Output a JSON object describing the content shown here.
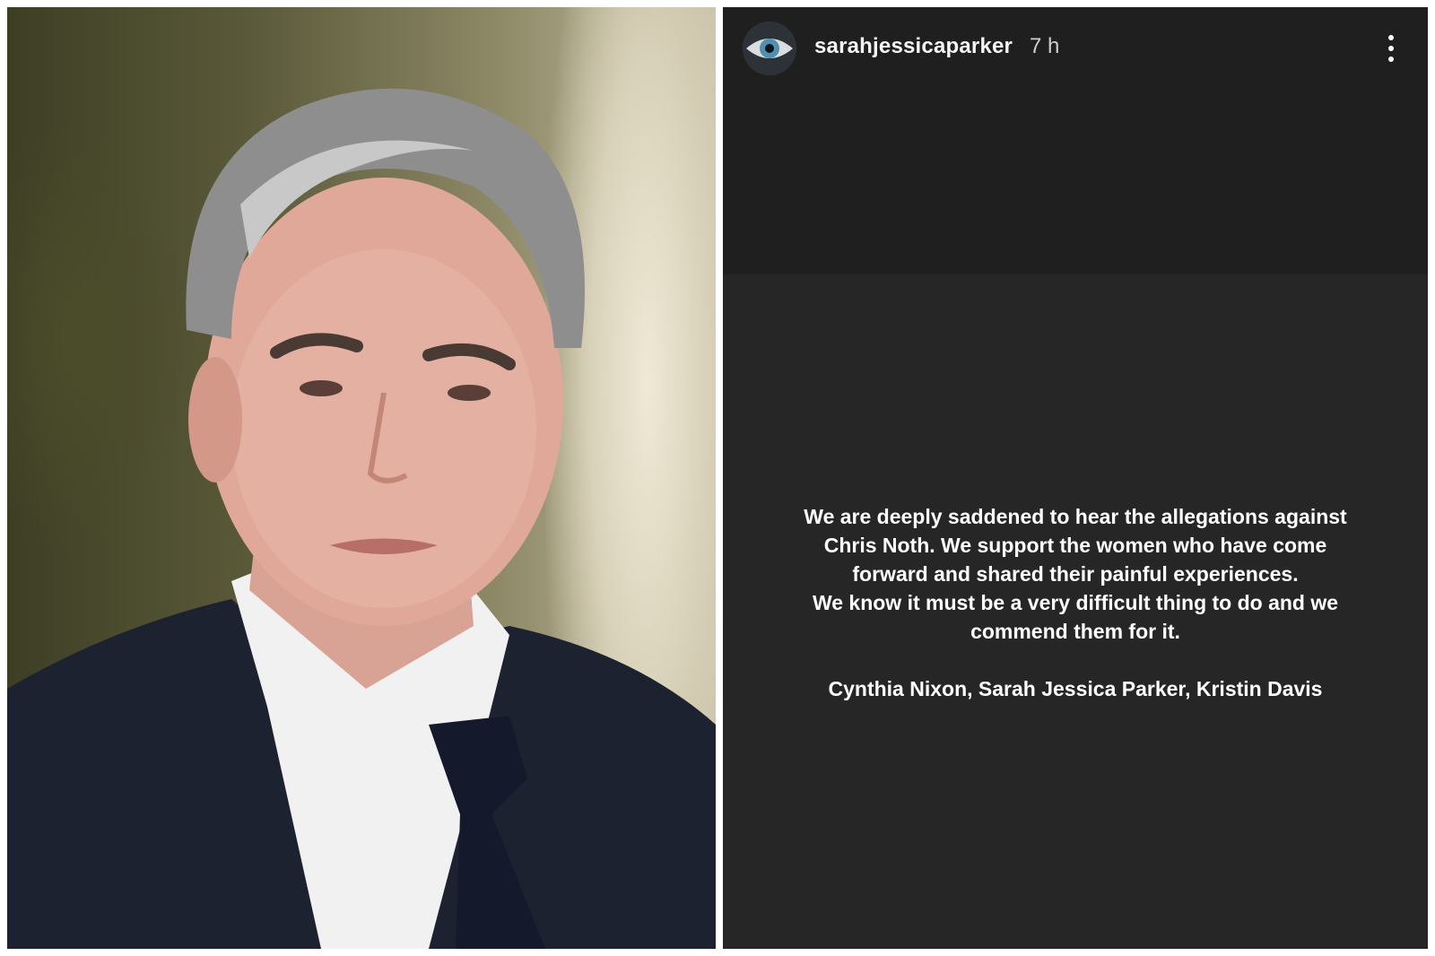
{
  "story": {
    "username": "sarahjessicaparker",
    "time_ago": "7 h",
    "statement_lines": [
      "We are deeply saddened to hear the allegations against",
      "Chris Noth. We support the women who have come",
      "forward and shared their painful experiences.",
      "We know it must be a very difficult thing to do and we",
      "commend them for it."
    ],
    "signature": "Cynthia Nixon, Sarah Jessica Parker, Kristin Davis"
  },
  "icons": {
    "avatar": "eye-avatar",
    "more": "more-vertical-icon"
  },
  "colors": {
    "story_background": "#262626",
    "story_top_background": "#1f1f1f",
    "text": "#ffffff"
  }
}
